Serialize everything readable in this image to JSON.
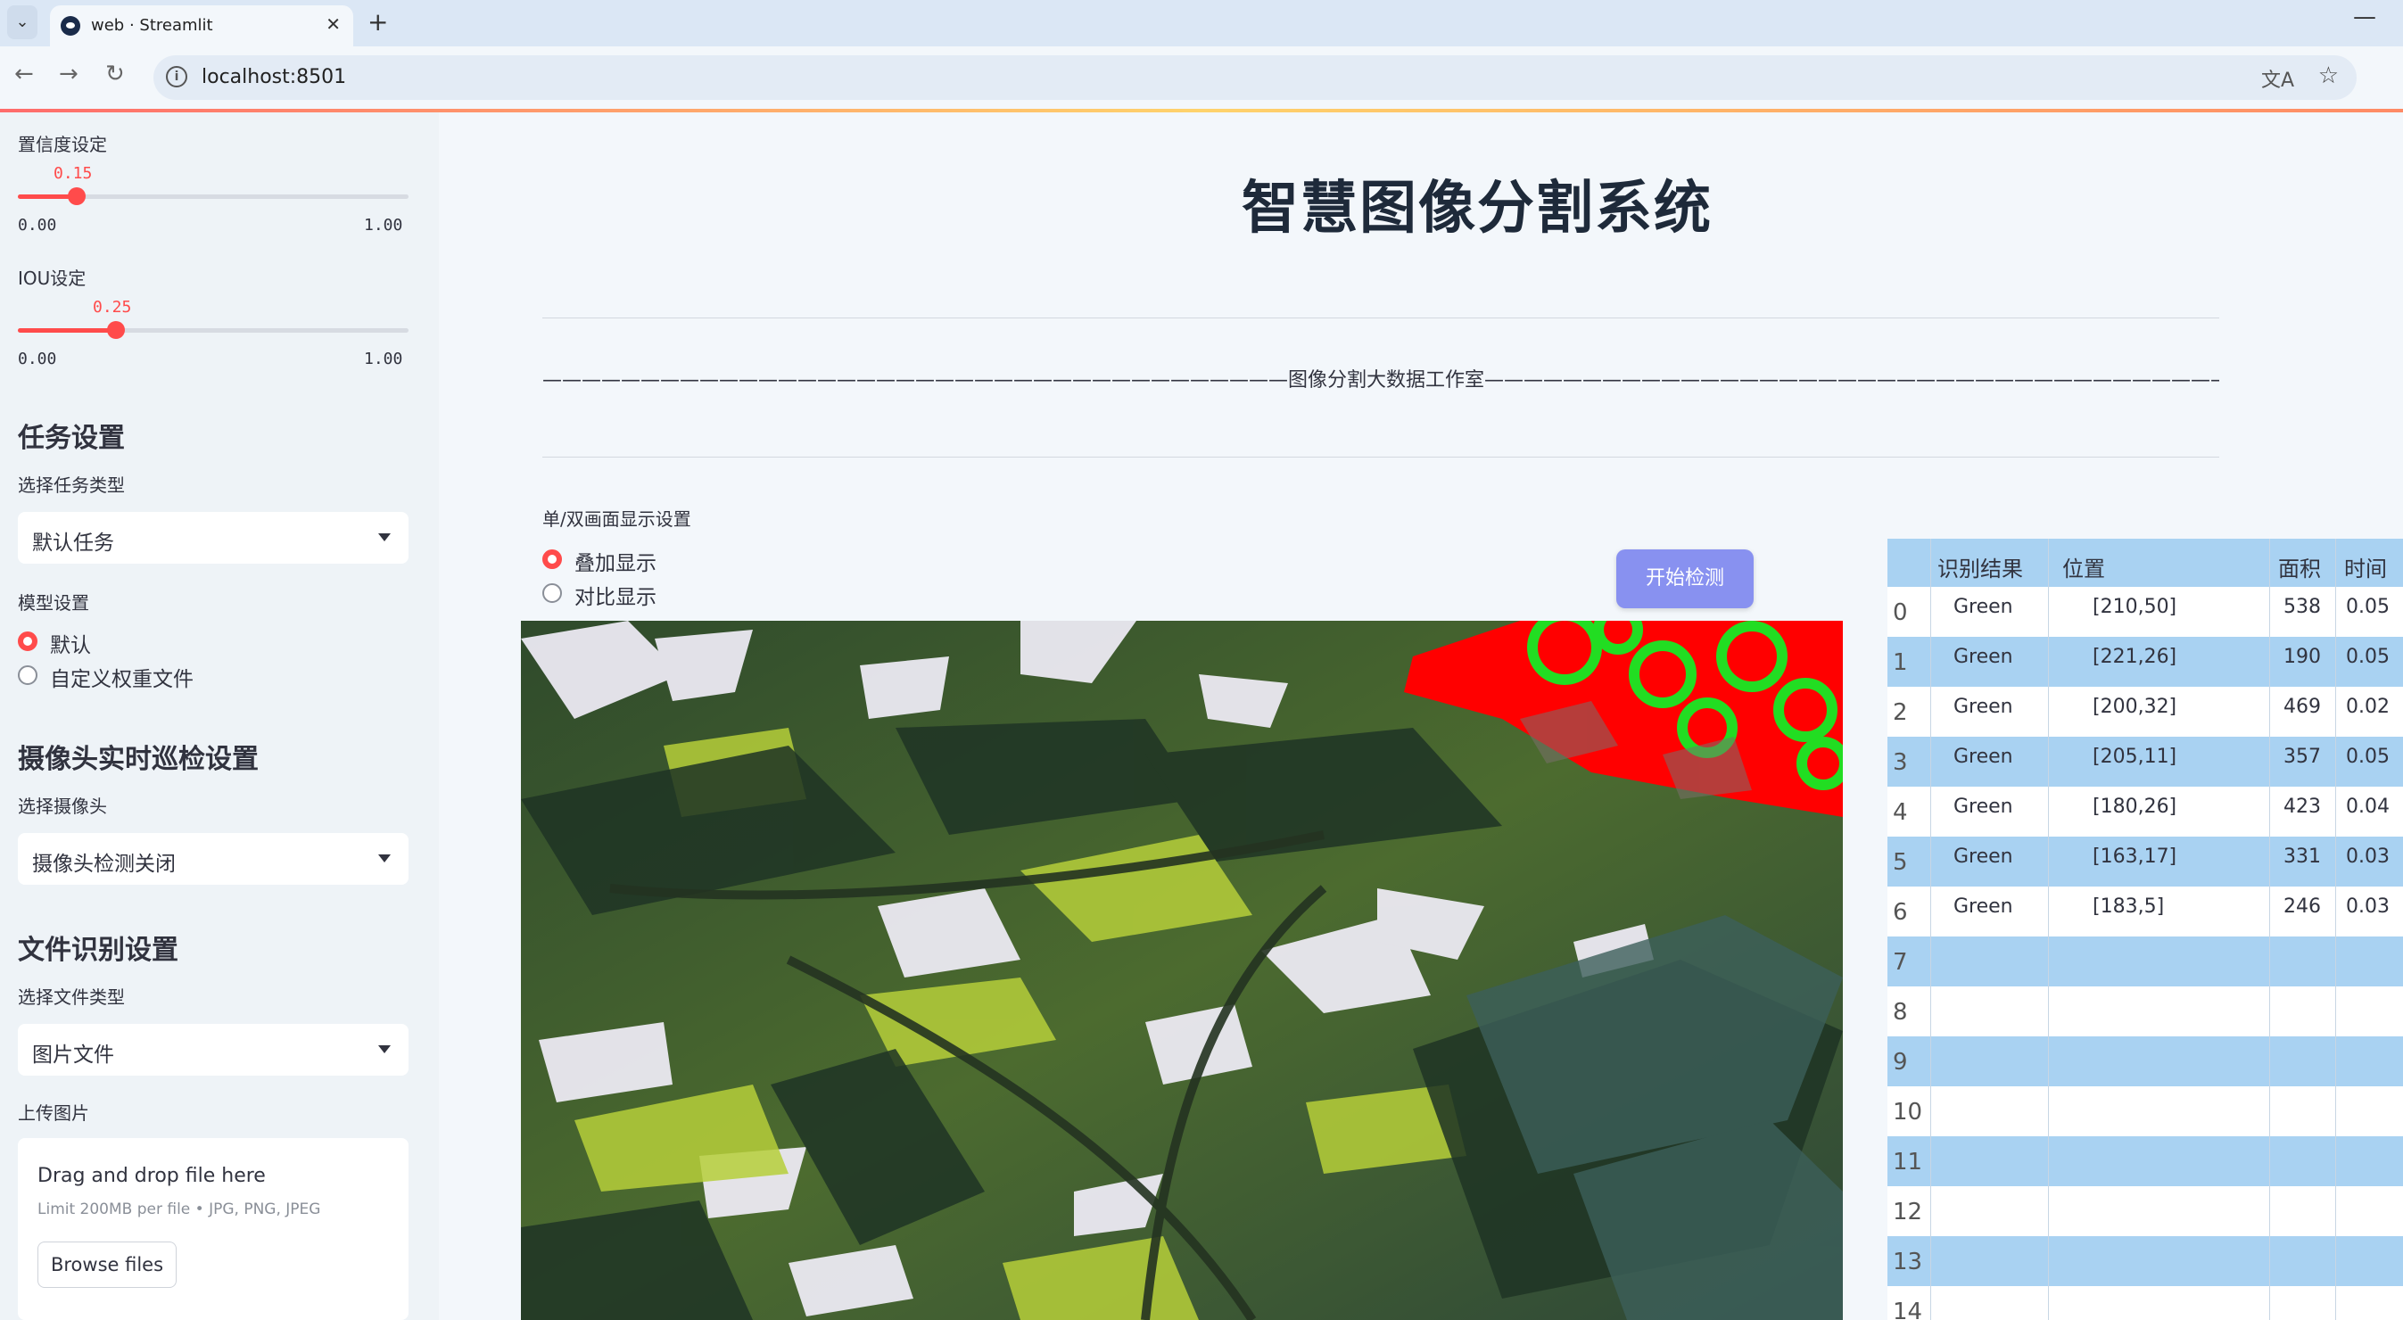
{
  "browser": {
    "tab_title": "web · Streamlit",
    "url": "localhost:8501"
  },
  "sidebar": {
    "confidence": {
      "label": "置信度设定",
      "value": "0.15",
      "min": "0.00",
      "max": "1.00",
      "fraction": 0.15
    },
    "iou": {
      "label": "IOU设定",
      "value": "0.25",
      "min": "0.00",
      "max": "1.00",
      "fraction": 0.25
    },
    "task_heading": "任务设置",
    "task_type_label": "选择任务类型",
    "task_type_value": "默认任务",
    "model_label": "模型设置",
    "model_options": [
      "默认",
      "自定义权重文件"
    ],
    "camera_heading": "摄像头实时巡检设置",
    "camera_label": "选择摄像头",
    "camera_value": "摄像头检测关闭",
    "file_heading": "文件识别设置",
    "file_type_label": "选择文件类型",
    "file_type_value": "图片文件",
    "upload_label": "上传图片",
    "upload_title": "Drag and drop file here",
    "upload_limit": "Limit 200MB per file • JPG, PNG, JPEG",
    "browse_label": "Browse files"
  },
  "main": {
    "title": "智慧图像分割系统",
    "studio_line": "——————————————————————————————————————图像分割大数据工作室——————————————————————————————————————",
    "display_label": "单/双画面显示设置",
    "display_options": [
      "叠加显示",
      "对比显示"
    ],
    "detect_button": "开始检测"
  },
  "table": {
    "headers": [
      "识别结果",
      "位置",
      "面积",
      "时间"
    ],
    "rows": [
      {
        "idx": "0",
        "result": "Green",
        "pos": "[210,50]",
        "area": "538",
        "time": "0.05"
      },
      {
        "idx": "1",
        "result": "Green",
        "pos": "[221,26]",
        "area": "190",
        "time": "0.05"
      },
      {
        "idx": "2",
        "result": "Green",
        "pos": "[200,32]",
        "area": "469",
        "time": "0.02"
      },
      {
        "idx": "3",
        "result": "Green",
        "pos": "[205,11]",
        "area": "357",
        "time": "0.05"
      },
      {
        "idx": "4",
        "result": "Green",
        "pos": "[180,26]",
        "area": "423",
        "time": "0.04"
      },
      {
        "idx": "5",
        "result": "Green",
        "pos": "[163,17]",
        "area": "331",
        "time": "0.03"
      },
      {
        "idx": "6",
        "result": "Green",
        "pos": "[183,5]",
        "area": "246",
        "time": "0.03"
      },
      {
        "idx": "7",
        "result": "",
        "pos": "",
        "area": "",
        "time": ""
      },
      {
        "idx": "8",
        "result": "",
        "pos": "",
        "area": "",
        "time": ""
      },
      {
        "idx": "9",
        "result": "",
        "pos": "",
        "area": "",
        "time": ""
      },
      {
        "idx": "10",
        "result": "",
        "pos": "",
        "area": "",
        "time": ""
      },
      {
        "idx": "11",
        "result": "",
        "pos": "",
        "area": "",
        "time": ""
      },
      {
        "idx": "12",
        "result": "",
        "pos": "",
        "area": "",
        "time": ""
      },
      {
        "idx": "13",
        "result": "",
        "pos": "",
        "area": "",
        "time": ""
      },
      {
        "idx": "14",
        "result": "",
        "pos": "",
        "area": "",
        "time": ""
      }
    ]
  },
  "colors": {
    "accent": "#ff4b4b",
    "button": "#8891f0",
    "table_header": "#a9d2f2",
    "mask_red": "#ff0000",
    "contour_green": "#22dd22"
  }
}
